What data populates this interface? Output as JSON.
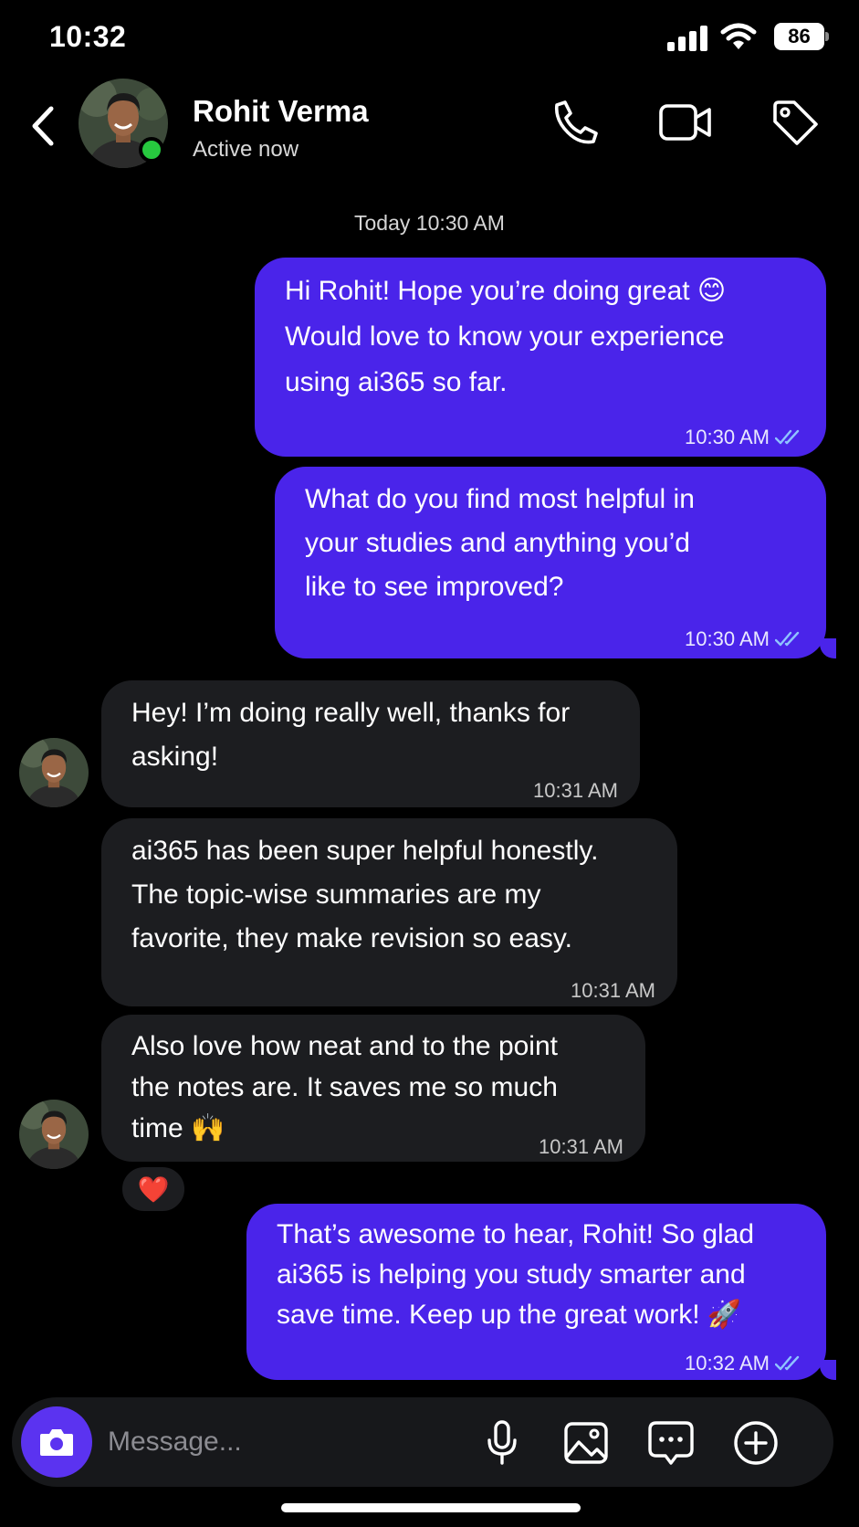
{
  "status_bar": {
    "time": "10:32",
    "battery": "86"
  },
  "header": {
    "name": "Rohit Verma",
    "status": "Active now"
  },
  "date_separator": "Today 10:30 AM",
  "messages": [
    {
      "direction": "out",
      "text": "Hi Rohit! Hope you’re doing great 😊\nWould love to know your experience\nusing ai365 so far.",
      "time": "10:30 AM"
    },
    {
      "direction": "out",
      "text": "What do you find most helpful in\nyour studies and anything you’d\nlike to see improved?",
      "time": "10:30 AM"
    },
    {
      "direction": "in",
      "text": "Hey! I’m doing really well, thanks for\nasking!",
      "time": "10:31 AM"
    },
    {
      "direction": "in",
      "text": "ai365 has been super helpful honestly.\nThe topic-wise summaries are my\nfavorite, they make revision so easy.",
      "time": "10:31 AM"
    },
    {
      "direction": "in",
      "text": "Also love how neat and to the point\nthe notes are. It saves me so much\ntime 🙌",
      "time": "10:31 AM",
      "reaction": "❤️"
    },
    {
      "direction": "out",
      "text": "That’s awesome to hear, Rohit! So glad\nai365 is helping you study smarter and\nsave time. Keep up the great work! 🚀",
      "time": "10:32 AM"
    }
  ],
  "composer": {
    "placeholder": "Message..."
  },
  "icons": {
    "back": "chevron-left-icon",
    "call": "phone-icon",
    "video": "video-camera-icon",
    "tag": "tag-icon",
    "camera": "camera-icon",
    "mic": "microphone-icon",
    "gallery": "image-icon",
    "sticker": "chat-bubble-icon",
    "more": "plus-circle-icon",
    "read": "double-check-icon"
  },
  "colors": {
    "outgoing_bubble": "#4a24ea",
    "incoming_bubble": "#1c1d20",
    "online": "#27c93f",
    "read_receipt": "#8fc3ff"
  }
}
